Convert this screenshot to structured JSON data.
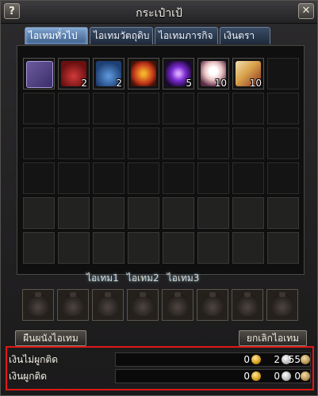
{
  "window": {
    "title": "กระเป๋าเป้",
    "help_label": "?",
    "close_label": "✕"
  },
  "tabs": [
    {
      "label": "ไอเทมทั่วไป",
      "active": true
    },
    {
      "label": "ไอเทมวัตถุดิบ",
      "active": false
    },
    {
      "label": "ไอเทมภารกิจ",
      "active": false
    },
    {
      "label": "เงินตรา",
      "active": false
    }
  ],
  "inventory": {
    "columns": 8,
    "rows": 6,
    "items": [
      {
        "slot": 0,
        "icon": "scroll-icon",
        "qty": ""
      },
      {
        "slot": 1,
        "icon": "red-gourd-potion-icon",
        "qty": "2"
      },
      {
        "slot": 2,
        "icon": "blue-gourd-potion-icon",
        "qty": "2"
      },
      {
        "slot": 3,
        "icon": "fire-orb-icon",
        "qty": ""
      },
      {
        "slot": 4,
        "icon": "purple-star-icon",
        "qty": "5"
      },
      {
        "slot": 5,
        "icon": "spirit-mask-icon",
        "qty": "10"
      },
      {
        "slot": 6,
        "icon": "paper-talisman-icon",
        "qty": "10"
      }
    ],
    "locked_from_row": 4
  },
  "quick_labels": [
    "ไอเทม1",
    "ไอเทม2",
    "ไอเทม3"
  ],
  "quick_slots": 8,
  "buttons": {
    "left": "ผืนผนังไอเทม",
    "right": "ยกเลิกไอเทม"
  },
  "currency": {
    "rows": [
      {
        "label": "เงินไม่ผูกติด",
        "gold": "0",
        "silver": "2",
        "bronze": "55"
      },
      {
        "label": "เงินผูกติด",
        "gold": "0",
        "silver": "0",
        "bronze": "0"
      }
    ],
    "highlight_color": "#e01818"
  }
}
